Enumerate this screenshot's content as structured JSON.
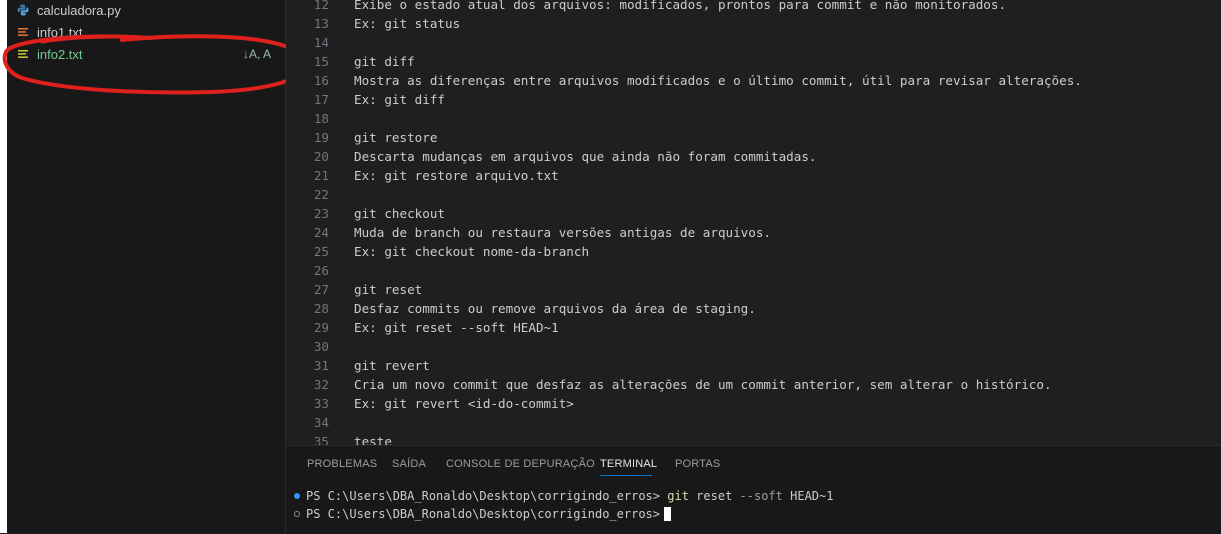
{
  "explorer": {
    "files": [
      {
        "name": "calculadora.py",
        "icon": "python-file-icon",
        "color": "#cccccc",
        "status": ""
      },
      {
        "name": "info1.txt",
        "icon": "text-file-icon",
        "color": "#cccccc",
        "status": ""
      },
      {
        "name": "info2.txt",
        "icon": "text-file-icon",
        "color": "#73c991",
        "status": "↓A, A"
      }
    ]
  },
  "editor": {
    "lines": [
      {
        "n": "12",
        "text": "Exibe o estado atual dos arquivos: modificados, prontos para commit e não monitorados."
      },
      {
        "n": "13",
        "text": "Ex: git status"
      },
      {
        "n": "14",
        "text": ""
      },
      {
        "n": "15",
        "text": "git diff"
      },
      {
        "n": "16",
        "text": "Mostra as diferenças entre arquivos modificados e o último commit, útil para revisar alterações."
      },
      {
        "n": "17",
        "text": "Ex: git diff"
      },
      {
        "n": "18",
        "text": ""
      },
      {
        "n": "19",
        "text": "git restore"
      },
      {
        "n": "20",
        "text": "Descarta mudanças em arquivos que ainda não foram commitadas."
      },
      {
        "n": "21",
        "text": "Ex: git restore arquivo.txt"
      },
      {
        "n": "22",
        "text": ""
      },
      {
        "n": "23",
        "text": "git checkout"
      },
      {
        "n": "24",
        "text": "Muda de branch ou restaura versões antigas de arquivos."
      },
      {
        "n": "25",
        "text": "Ex: git checkout nome-da-branch"
      },
      {
        "n": "26",
        "text": ""
      },
      {
        "n": "27",
        "text": "git reset"
      },
      {
        "n": "28",
        "text": "Desfaz commits ou remove arquivos da área de staging."
      },
      {
        "n": "29",
        "text": "Ex: git reset --soft HEAD~1"
      },
      {
        "n": "30",
        "text": ""
      },
      {
        "n": "31",
        "text": "git revert"
      },
      {
        "n": "32",
        "text": "Cria um novo commit que desfaz as alterações de um commit anterior, sem alterar o histórico."
      },
      {
        "n": "33",
        "text": "Ex: git revert <id-do-commit>"
      },
      {
        "n": "34",
        "text": ""
      },
      {
        "n": "35",
        "text": "teste"
      }
    ]
  },
  "panel": {
    "tabs": [
      "PROBLEMAS",
      "SAÍDA",
      "CONSOLE DE DEPURAÇÃO",
      "TERMINAL",
      "PORTAS"
    ],
    "active_tab": "TERMINAL"
  },
  "terminal": {
    "lines": [
      {
        "prompt": "PS C:\\Users\\DBA_Ronaldo\\Desktop\\corrigindo_erros>",
        "cmd": "git",
        "args": "reset",
        "flag": "--soft",
        "rest": "HEAD~1",
        "dot": "filled"
      },
      {
        "prompt": "PS C:\\Users\\DBA_Ronaldo\\Desktop\\corrigindo_erros>",
        "cmd": "",
        "args": "",
        "flag": "",
        "rest": "",
        "dot": "hollow"
      }
    ]
  },
  "colors": {
    "accent": "#0078d4",
    "annotation": "#e0201c",
    "added_file": "#73c991"
  }
}
